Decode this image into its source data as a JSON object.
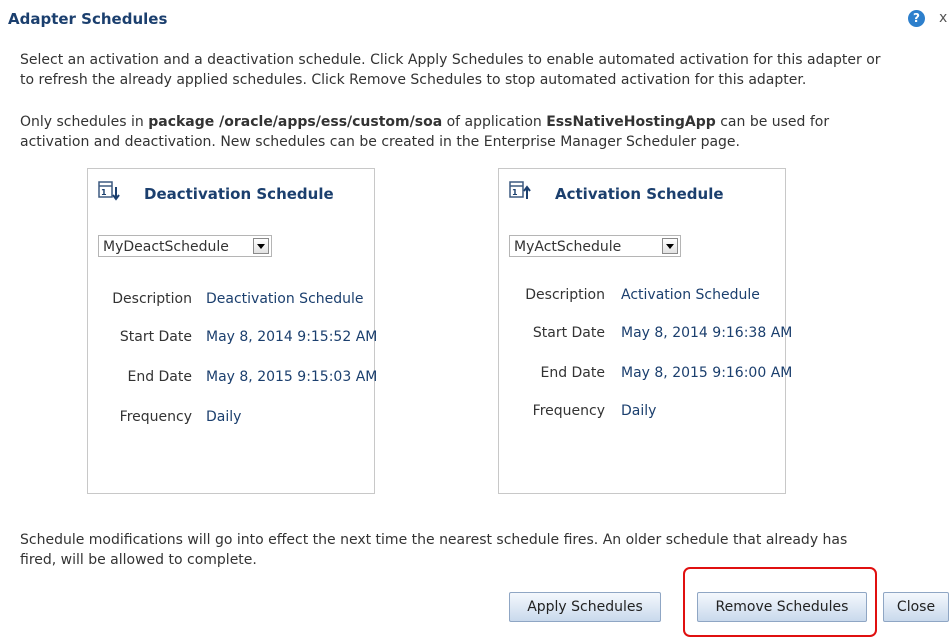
{
  "dialog": {
    "title": "Adapter Schedules",
    "help_icon_glyph": "?",
    "close_glyph": "x"
  },
  "intro": {
    "line1": "Select an activation and a deactivation schedule. Click Apply Schedules to enable automated activation for this adapter or",
    "line2": "to refresh the already applied schedules. Click Remove Schedules to stop automated activation for this adapter."
  },
  "package_note": {
    "prefix": "Only schedules in ",
    "package": "package /oracle/apps/ess/custom/soa",
    "middle": " of application ",
    "application": "EssNativeHostingApp",
    "suffix": " can be used for",
    "line2": "activation and deactivation. New schedules can be created in the Enterprise Manager Scheduler page."
  },
  "deactivation": {
    "title": "Deactivation Schedule",
    "icon": "calendar-down-arrow-icon",
    "selected": "MyDeactSchedule",
    "description_label": "Description",
    "description": "Deactivation Schedule",
    "start_label": "Start Date",
    "start": "May 8, 2014 9:15:52 AM",
    "end_label": "End Date",
    "end": "May 8, 2015 9:15:03 AM",
    "frequency_label": "Frequency",
    "frequency": "Daily"
  },
  "activation": {
    "title": "Activation Schedule",
    "icon": "calendar-up-arrow-icon",
    "selected": "MyActSchedule",
    "description_label": "Description",
    "description": "Activation Schedule",
    "start_label": "Start Date",
    "start": "May 8, 2014 9:16:38 AM",
    "end_label": "End Date",
    "end": "May 8, 2015 9:16:00 AM",
    "frequency_label": "Frequency",
    "frequency": "Daily"
  },
  "footer_note": {
    "line1": "Schedule modifications will go into effect the next time the nearest schedule fires. An older schedule that already has",
    "line2": "fired, will be allowed to complete."
  },
  "buttons": {
    "apply": "Apply Schedules",
    "remove": "Remove Schedules",
    "close": "Close"
  },
  "colors": {
    "title_blue": "#1b3f6e",
    "highlight_red": "#e01010",
    "button_bg": "#c9d9ec"
  }
}
